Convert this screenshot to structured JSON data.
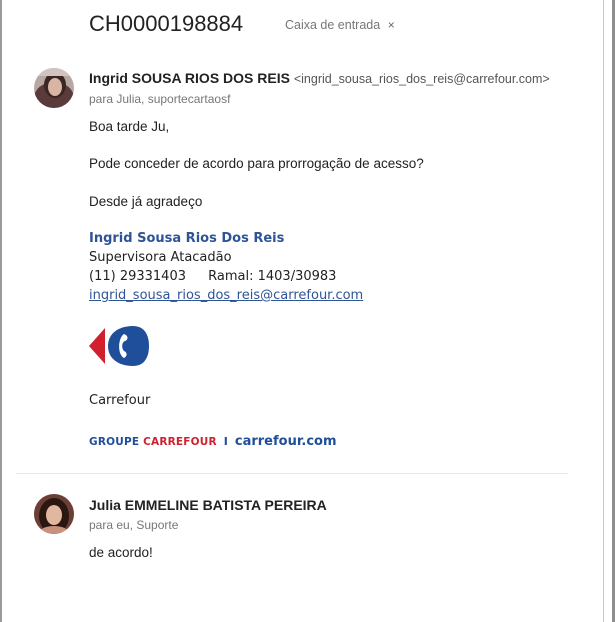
{
  "thread": {
    "subject": "CH0000198884",
    "label": {
      "name": "Caixa de entrada",
      "remove_icon": "×"
    }
  },
  "messages": [
    {
      "sender_name": "Ingrid SOUSA RIOS DOS REIS",
      "sender_email": "<ingrid_sousa_rios_dos_reis@carrefour.com>",
      "recipients": "para Julia, suportecartaosf",
      "greeting": "Boa tarde Ju,",
      "paragraph": "Pode conceder de acordo para prorrogação de acesso?",
      "closing": "Desde já agradeço",
      "signature": {
        "name": "Ingrid Sousa Rios Dos Reis",
        "title": "Supervisora Atacadão",
        "phone": "(11) 29331403",
        "ramal": "Ramal: 1403/30983",
        "email_link": "ingrid_sousa_rios_dos_reis@carrefour.com",
        "logo_icon": "carrefour-logo-icon",
        "company": "Carrefour",
        "brand_left_a": "GROUPE ",
        "brand_left_b": "CARREFOUR",
        "brand_separator": "I",
        "brand_right": "carrefour.com"
      }
    },
    {
      "sender_name": "Julia EMMELINE BATISTA PEREIRA",
      "recipients": "para eu, Suporte",
      "body": "de acordo!"
    }
  ],
  "colors": {
    "signature_blue": "#2f5496",
    "carrefour_red": "#d0202e",
    "carrefour_blue": "#1f4e9a"
  }
}
